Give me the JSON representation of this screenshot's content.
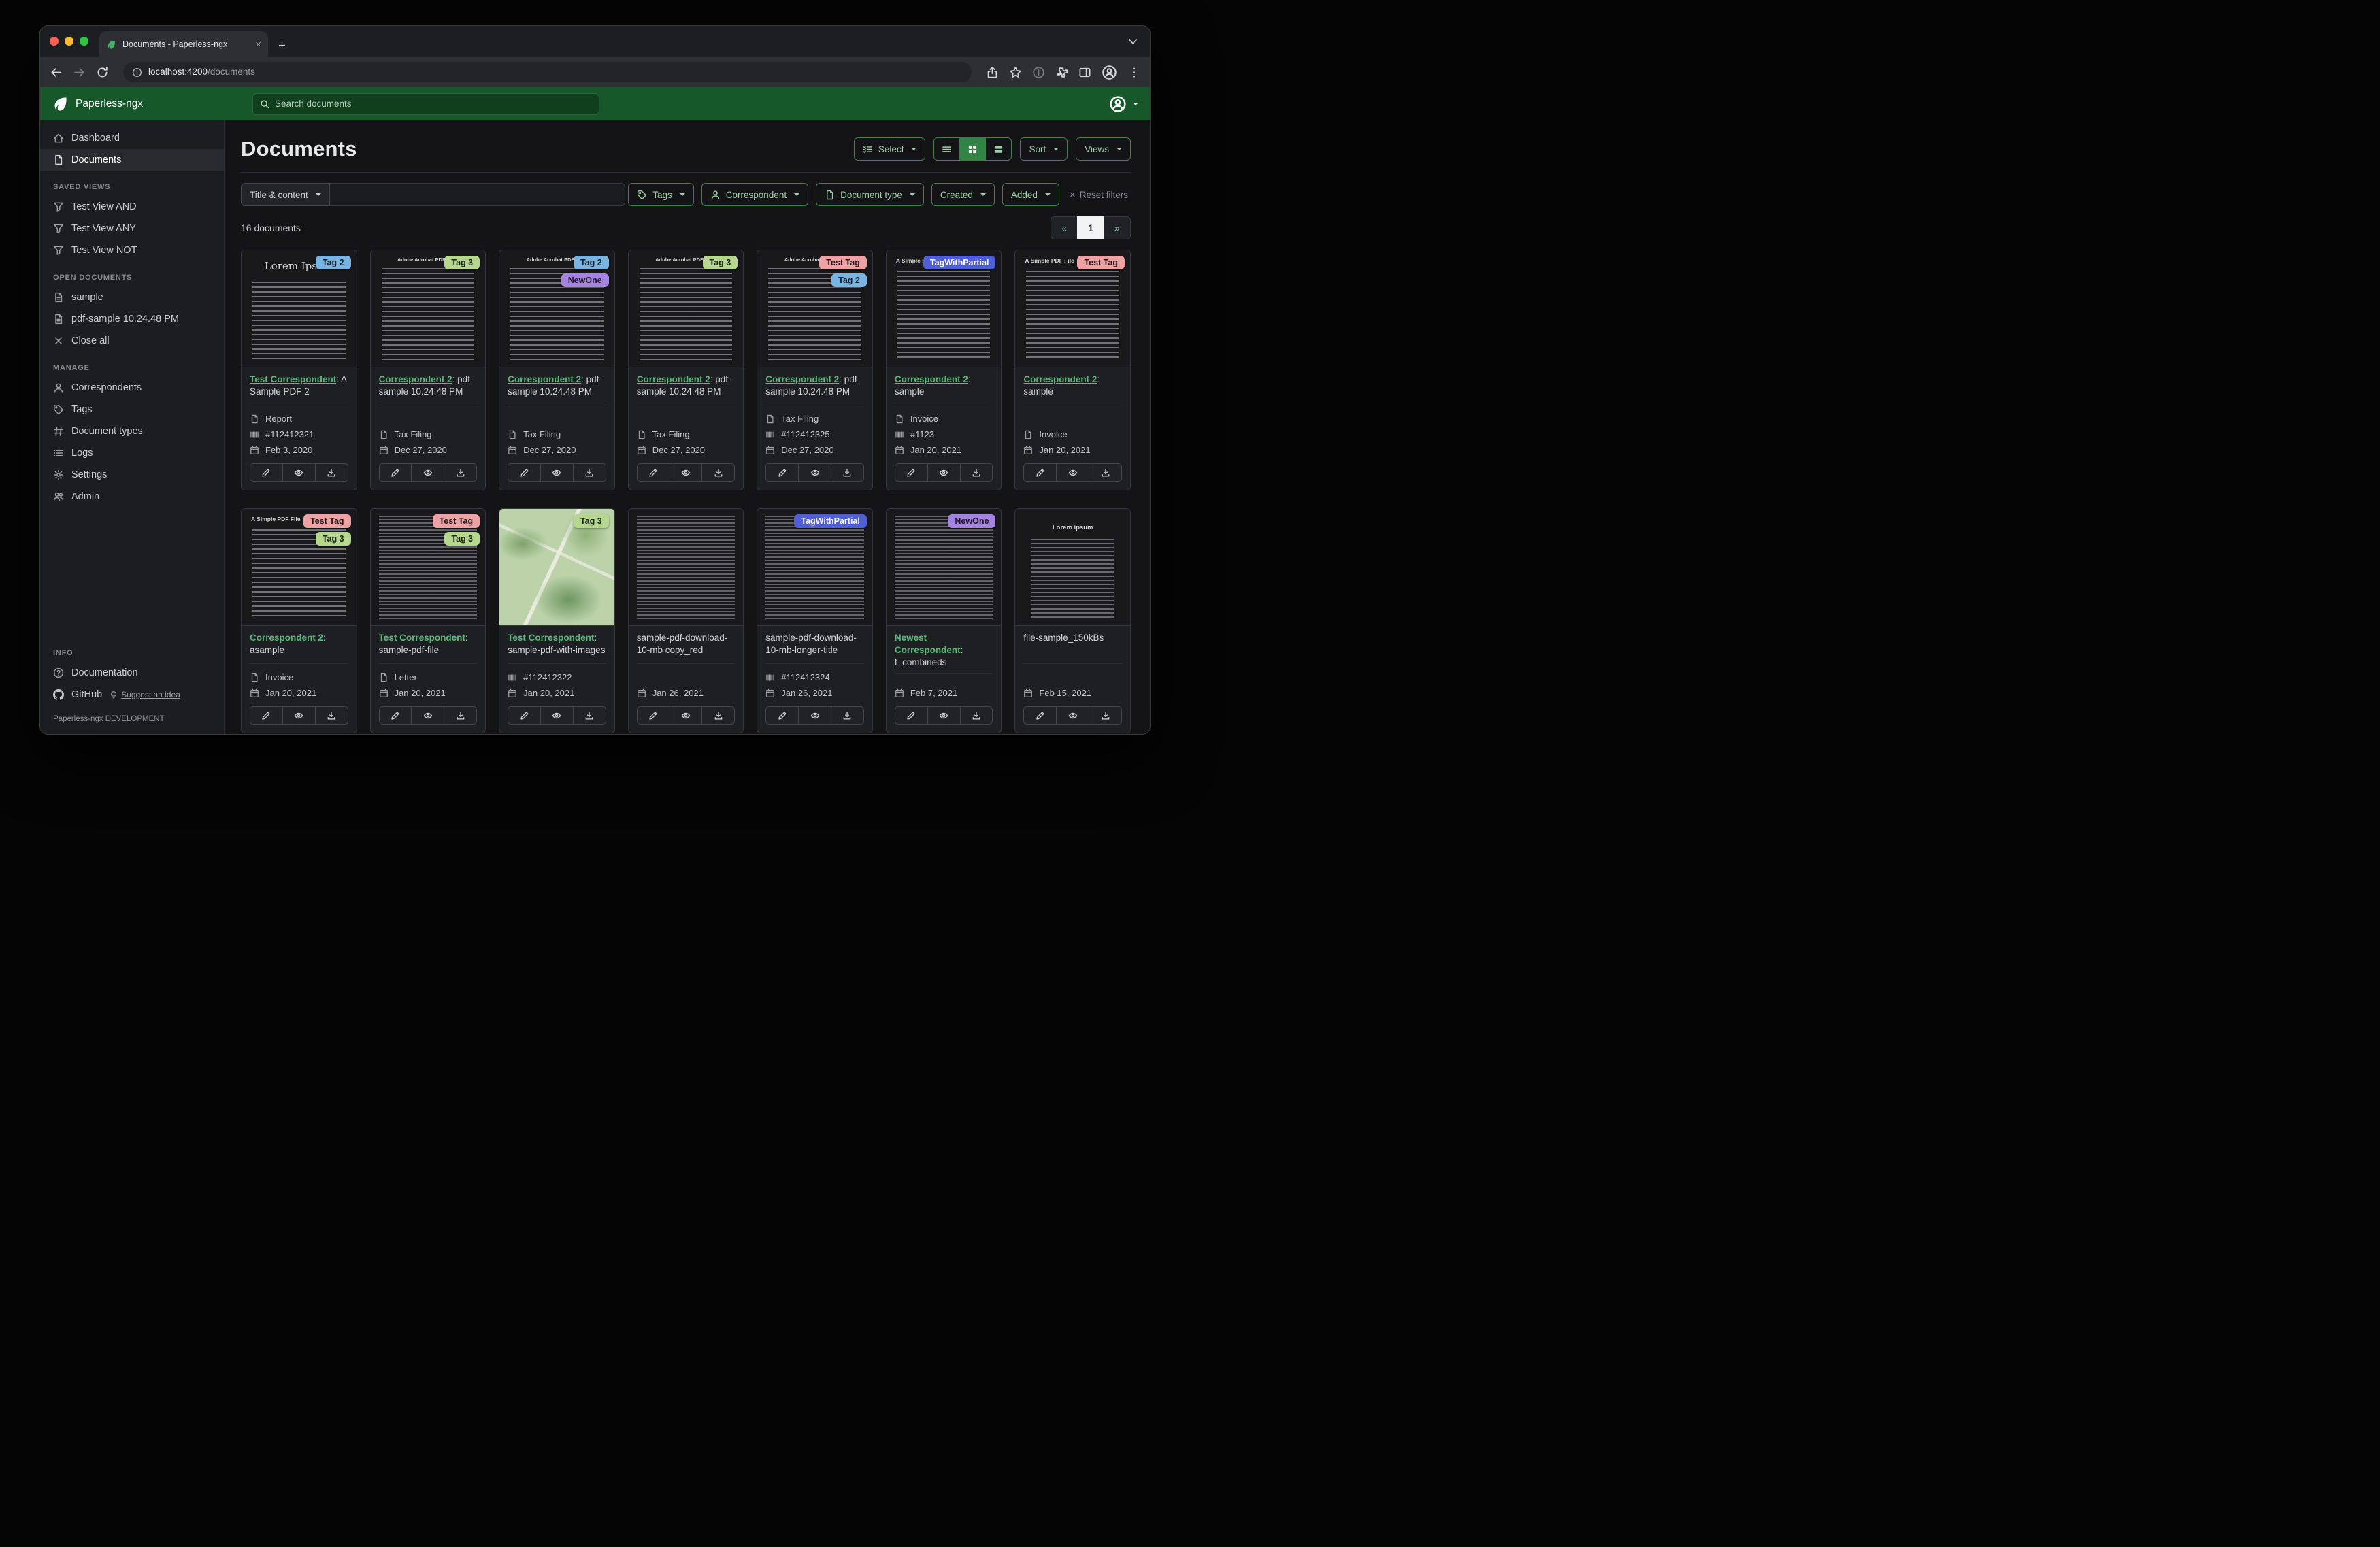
{
  "browser": {
    "tab_title": "Documents - Paperless-ngx",
    "url_host": "localhost:4200",
    "url_path": "/documents"
  },
  "navbar": {
    "brand": "Paperless-ngx",
    "search_placeholder": "Search documents"
  },
  "sidebar": {
    "dashboard": "Dashboard",
    "documents": "Documents",
    "saved_views_title": "SAVED VIEWS",
    "saved_views": [
      "Test View AND",
      "Test View ANY",
      "Test View NOT"
    ],
    "open_documents_title": "OPEN DOCUMENTS",
    "open_documents": [
      "sample",
      "pdf-sample 10.24.48 PM"
    ],
    "close_all": "Close all",
    "manage_title": "MANAGE",
    "manage": [
      "Correspondents",
      "Tags",
      "Document types",
      "Logs",
      "Settings",
      "Admin"
    ],
    "info_title": "INFO",
    "documentation": "Documentation",
    "github": "GitHub",
    "suggest": "Suggest an idea",
    "footer": "Paperless-ngx DEVELOPMENT"
  },
  "page": {
    "title": "Documents",
    "count": "16 documents",
    "select_label": "Select",
    "sort_label": "Sort",
    "views_label": "Views",
    "filter_title_content": "Title & content",
    "filter_tags": "Tags",
    "filter_correspondent": "Correspondent",
    "filter_document_type": "Document type",
    "filter_created": "Created",
    "filter_added": "Added",
    "reset_filters": "Reset filters",
    "pagination": {
      "prev": "«",
      "current": "1",
      "next": "»"
    }
  },
  "icons": {
    "search-icon": "magnifier",
    "user-icon": "person-circle",
    "leaf-icon": "paperless-leaf",
    "filter-icon": "funnel",
    "gear-icon": "cog",
    "edit-icon": "pencil",
    "view-icon": "eye",
    "download-icon": "arrow-into-tray",
    "calendar-icon": "calendar",
    "asn-icon": "barcode"
  },
  "tag_colors": {
    "Tag 2": {
      "bg": "#79b5e2",
      "fg": "#16202a"
    },
    "Tag 3": {
      "bg": "#b5d78e",
      "fg": "#1b2413"
    },
    "NewOne": {
      "bg": "#a583e0",
      "fg": "#1d1528"
    },
    "Test Tag": {
      "bg": "#efa2a4",
      "fg": "#2a1717"
    },
    "TagWithPartial": {
      "bg": "#4f5fd7",
      "fg": "#ffffff"
    }
  },
  "documents": [
    {
      "tags": [
        "Tag 2"
      ],
      "correspondent": "Test Correspondent",
      "title": "A Sample PDF 2",
      "doc_type": "Report",
      "asn": "#112412321",
      "date": "Feb 3, 2020",
      "thumb": "lorem",
      "thumb_text": "Lorem Ipsum"
    },
    {
      "tags": [
        "Tag 3"
      ],
      "correspondent": "Correspondent 2",
      "title": "pdf-sample 10.24.48 PM",
      "doc_type": "Tax Filing",
      "asn": null,
      "date": "Dec 27, 2020",
      "thumb": "pdf",
      "thumb_text": "Adobe Acrobat PDF Files"
    },
    {
      "tags": [
        "Tag 2",
        "NewOne"
      ],
      "correspondent": "Correspondent 2",
      "title": "pdf-sample 10.24.48 PM",
      "doc_type": "Tax Filing",
      "asn": null,
      "date": "Dec 27, 2020",
      "thumb": "pdf",
      "thumb_text": "Adobe Acrobat PDF Files"
    },
    {
      "tags": [
        "Tag 3"
      ],
      "correspondent": "Correspondent 2",
      "title": "pdf-sample 10.24.48 PM",
      "doc_type": "Tax Filing",
      "asn": null,
      "date": "Dec 27, 2020",
      "thumb": "pdf",
      "thumb_text": "Adobe Acrobat PDF Files"
    },
    {
      "tags": [
        "Test Tag",
        "Tag 2"
      ],
      "correspondent": "Correspondent 2",
      "title": "pdf-sample 10.24.48 PM",
      "doc_type": "Tax Filing",
      "asn": "#112412325",
      "date": "Dec 27, 2020",
      "thumb": "pdf",
      "thumb_text": "Adobe Acrobat PDF Files"
    },
    {
      "tags": [
        "TagWithPartial"
      ],
      "correspondent": "Correspondent 2",
      "title": "sample",
      "doc_type": "Invoice",
      "asn": "#1123",
      "date": "Jan 20, 2021",
      "thumb": "simple",
      "thumb_text": "A Simple PDF File"
    },
    {
      "tags": [
        "Test Tag"
      ],
      "correspondent": "Correspondent 2",
      "title": "sample",
      "doc_type": "Invoice",
      "asn": null,
      "date": "Jan 20, 2021",
      "thumb": "simple",
      "thumb_text": "A Simple PDF File"
    },
    {
      "tags": [
        "Test Tag",
        "Tag 3"
      ],
      "correspondent": "Correspondent 2",
      "title": "asample",
      "doc_type": "Invoice",
      "asn": null,
      "date": "Jan 20, 2021",
      "thumb": "simple",
      "thumb_text": "A Simple PDF File"
    },
    {
      "tags": [
        "Test Tag",
        "Tag 3"
      ],
      "correspondent": "Test Correspondent",
      "title": "sample-pdf-file",
      "doc_type": "Letter",
      "asn": null,
      "date": "Jan 20, 2021",
      "thumb": "dense",
      "thumb_text": ""
    },
    {
      "tags": [
        "Tag 3"
      ],
      "correspondent": "Test Correspondent",
      "title": "sample-pdf-with-images",
      "doc_type": null,
      "asn": "#112412322",
      "date": "Jan 20, 2021",
      "thumb": "map",
      "thumb_text": ""
    },
    {
      "tags": [],
      "correspondent": null,
      "title": "sample-pdf-download-10-mb copy_red",
      "doc_type": null,
      "asn": null,
      "date": "Jan 26, 2021",
      "thumb": "dense",
      "thumb_text": ""
    },
    {
      "tags": [
        "TagWithPartial"
      ],
      "correspondent": null,
      "title": "sample-pdf-download-10-mb-longer-title",
      "doc_type": null,
      "asn": "#112412324",
      "date": "Jan 26, 2021",
      "thumb": "dense",
      "thumb_text": ""
    },
    {
      "tags": [
        "NewOne"
      ],
      "correspondent": "Newest Correspondent",
      "title": "f_combineds",
      "doc_type": null,
      "asn": null,
      "date": "Feb 7, 2021",
      "thumb": "dense",
      "thumb_text": ""
    },
    {
      "tags": [],
      "correspondent": null,
      "title": "file-sample_150kBs",
      "doc_type": null,
      "asn": null,
      "date": "Feb 15, 2021",
      "thumb": "loremcenter",
      "thumb_text": "Lorem ipsum"
    }
  ]
}
